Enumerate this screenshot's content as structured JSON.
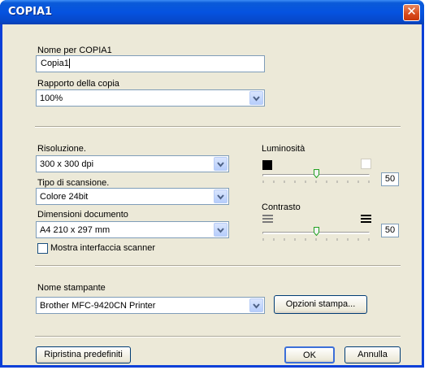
{
  "window": {
    "title": "COPIA1"
  },
  "name_field": {
    "label": "Nome per COPIA1",
    "value": "Copia1"
  },
  "ratio": {
    "label": "Rapporto della copia",
    "value": "100%"
  },
  "resolution": {
    "label": "Risoluzione.",
    "value": "300 x 300 dpi"
  },
  "scan_type": {
    "label": "Tipo di scansione.",
    "value": "Colore 24bit"
  },
  "doc_size": {
    "label": "Dimensioni documento",
    "value": "A4 210 x 297 mm"
  },
  "scanner_ui": {
    "label": "Mostra interfaccia scanner",
    "checked": false
  },
  "brightness": {
    "label": "Luminosità",
    "value": "50",
    "level": 0.5
  },
  "contrast": {
    "label": "Contrasto",
    "value": "50",
    "level": 0.5
  },
  "printer": {
    "label": "Nome stampante",
    "value": "Brother MFC-9420CN Printer",
    "options_button": "Opzioni stampa..."
  },
  "footer": {
    "reset_button": "Ripristina predefiniti",
    "ok_button": "OK",
    "cancel_button": "Annulla"
  },
  "colors": {
    "titlebar": "#0553e0",
    "dialog_bg": "#ece9d8",
    "close": "#d94a1c"
  }
}
